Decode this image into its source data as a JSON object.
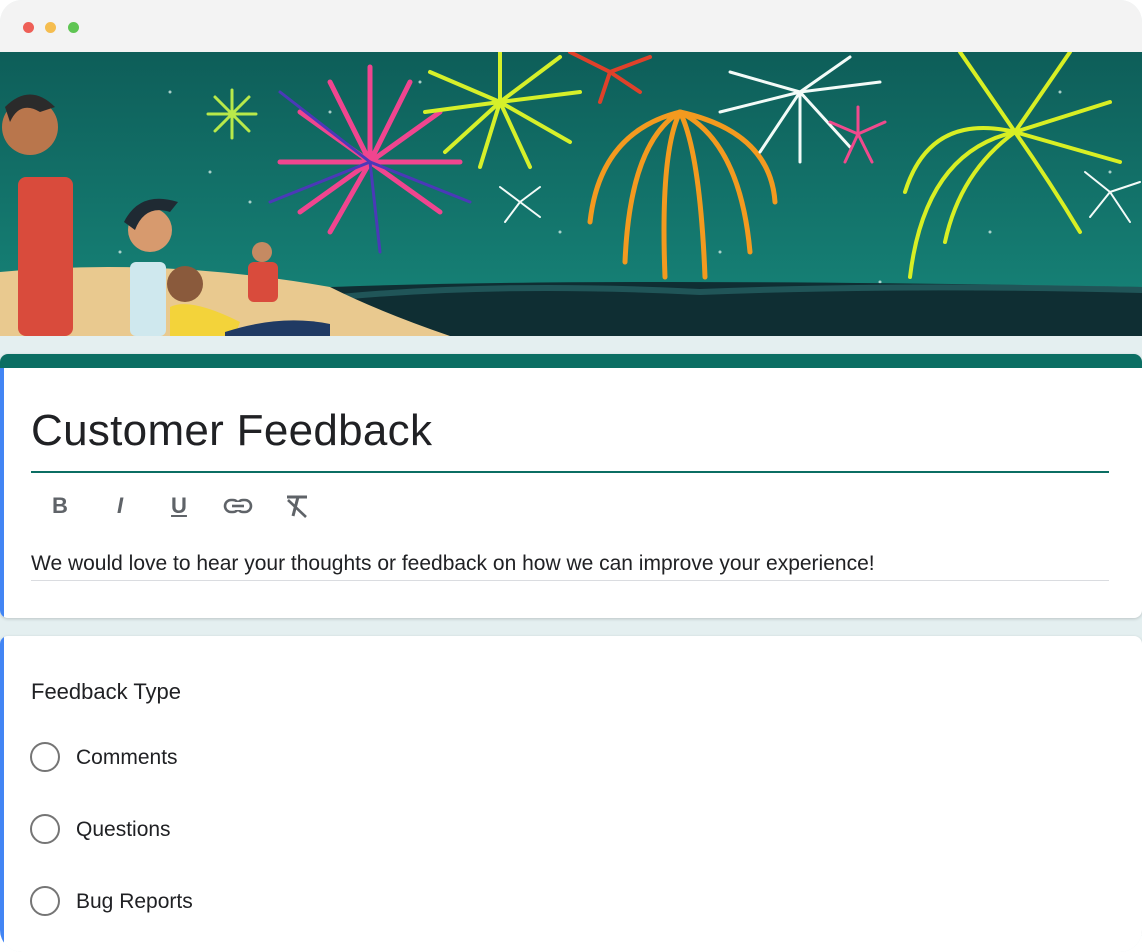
{
  "window": {
    "traffic_lights": [
      "close",
      "minimize",
      "maximize"
    ]
  },
  "banner": {
    "description_icon": "fireworks-beach-illustration"
  },
  "form": {
    "title": "Customer Feedback",
    "description": "We would love to hear your thoughts or feedback on how we can improve your experience!",
    "accent_color": "#0b6e63",
    "toolbar": {
      "bold": "B",
      "italic": "I",
      "underline": "U",
      "link_icon": "link-icon",
      "clear_icon": "clear-formatting-icon"
    }
  },
  "question": {
    "title": "Feedback Type",
    "options": [
      "Comments",
      "Questions",
      "Bug Reports"
    ]
  }
}
